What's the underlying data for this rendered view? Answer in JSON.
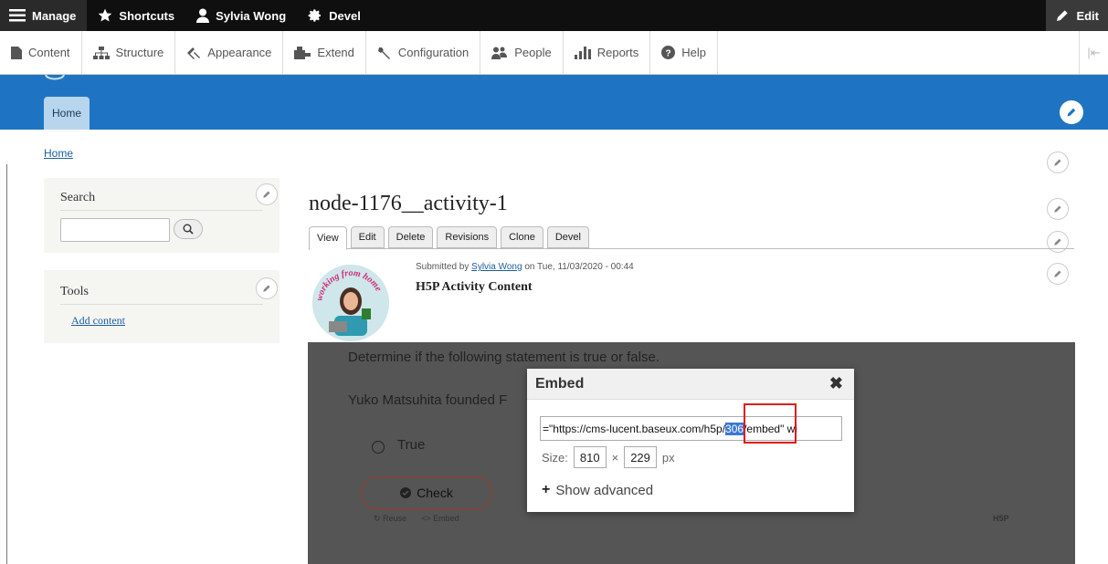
{
  "toolbar": {
    "manage": "Manage",
    "shortcuts": "Shortcuts",
    "user": "Sylvia Wong",
    "devel": "Devel",
    "edit": "Edit"
  },
  "tray": {
    "items": [
      "Content",
      "Structure",
      "Appearance",
      "Extend",
      "Configuration",
      "People",
      "Reports",
      "Help"
    ],
    "collapse": "|⇤"
  },
  "header": {
    "home_tab": "Home"
  },
  "breadcrumb": "Home",
  "sidebar": {
    "search_title": "Search",
    "tools_title": "Tools",
    "add_content": "Add content"
  },
  "node": {
    "title": "node-1176__activity-1",
    "tabs": [
      "View",
      "Edit",
      "Delete",
      "Revisions",
      "Clone",
      "Devel"
    ],
    "submitted_prefix": "Submitted by ",
    "author": "Sylvia Wong",
    "submitted_suffix": " on Tue, 11/03/2020 - 00:44",
    "subtitle": "H5P Activity Content",
    "avatar_text": "working from home"
  },
  "h5p": {
    "statement": "Determine if the following statement is true or false.",
    "question": "Yuko Matsuhita founded F",
    "option": "True",
    "check": "Check",
    "reuse": "Reuse",
    "embed": "<> Embed",
    "logo": "H5P"
  },
  "dialog": {
    "title": "Embed",
    "close": "✖",
    "code_before": "=\"https://cms-lucent.baseux.com/h5p/",
    "code_highlight": "306",
    "code_after": "/embed\" wi",
    "size_label": "Size:",
    "width": "810",
    "times": "×",
    "height": "229",
    "unit": "px",
    "show_advanced": "Show advanced"
  }
}
